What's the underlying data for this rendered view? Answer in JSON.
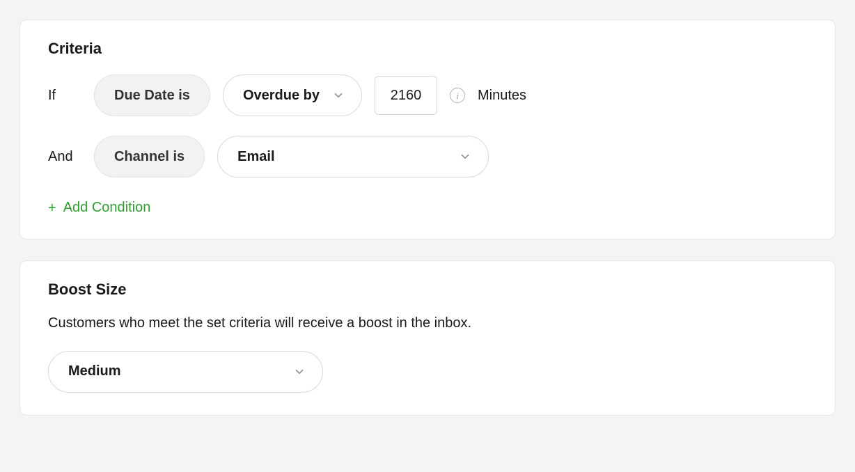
{
  "criteria": {
    "title": "Criteria",
    "rows": [
      {
        "prefix": "If",
        "field_label": "Due Date is",
        "operator": "Overdue by",
        "value": "2160",
        "unit": "Minutes"
      },
      {
        "prefix": "And",
        "field_label": "Channel is",
        "value_select": "Email"
      }
    ],
    "add_label": "Add Condition"
  },
  "boost": {
    "title": "Boost Size",
    "description": "Customers who meet the set criteria will receive a boost in the inbox.",
    "value": "Medium"
  }
}
